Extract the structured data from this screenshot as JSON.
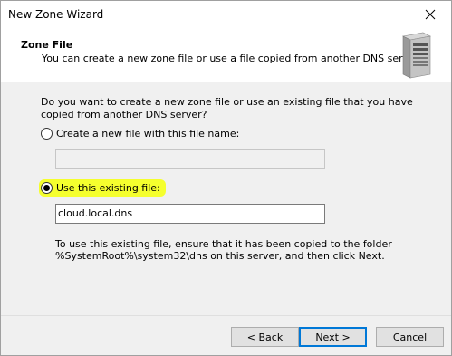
{
  "window": {
    "title": "New Zone Wizard"
  },
  "header": {
    "title": "Zone File",
    "subtitle": "You can create a new zone file or use a file copied from another DNS server.",
    "icon": "server-icon"
  },
  "content": {
    "question": "Do you want to create a new zone file or use an existing file that you have copied from another DNS server?",
    "option_new": {
      "label": "Create a new file with this file name:",
      "selected": false,
      "value": ""
    },
    "option_existing": {
      "label": "Use this existing file:",
      "selected": true,
      "value": "cloud.local.dns",
      "highlight": "#f5ff2e"
    },
    "note": "To use this existing file, ensure that it has been copied to the folder %SystemRoot%\\system32\\dns on this server, and then click Next."
  },
  "buttons": {
    "back": "< Back",
    "next": "Next >",
    "cancel": "Cancel"
  },
  "colors": {
    "accent": "#0078d7"
  }
}
